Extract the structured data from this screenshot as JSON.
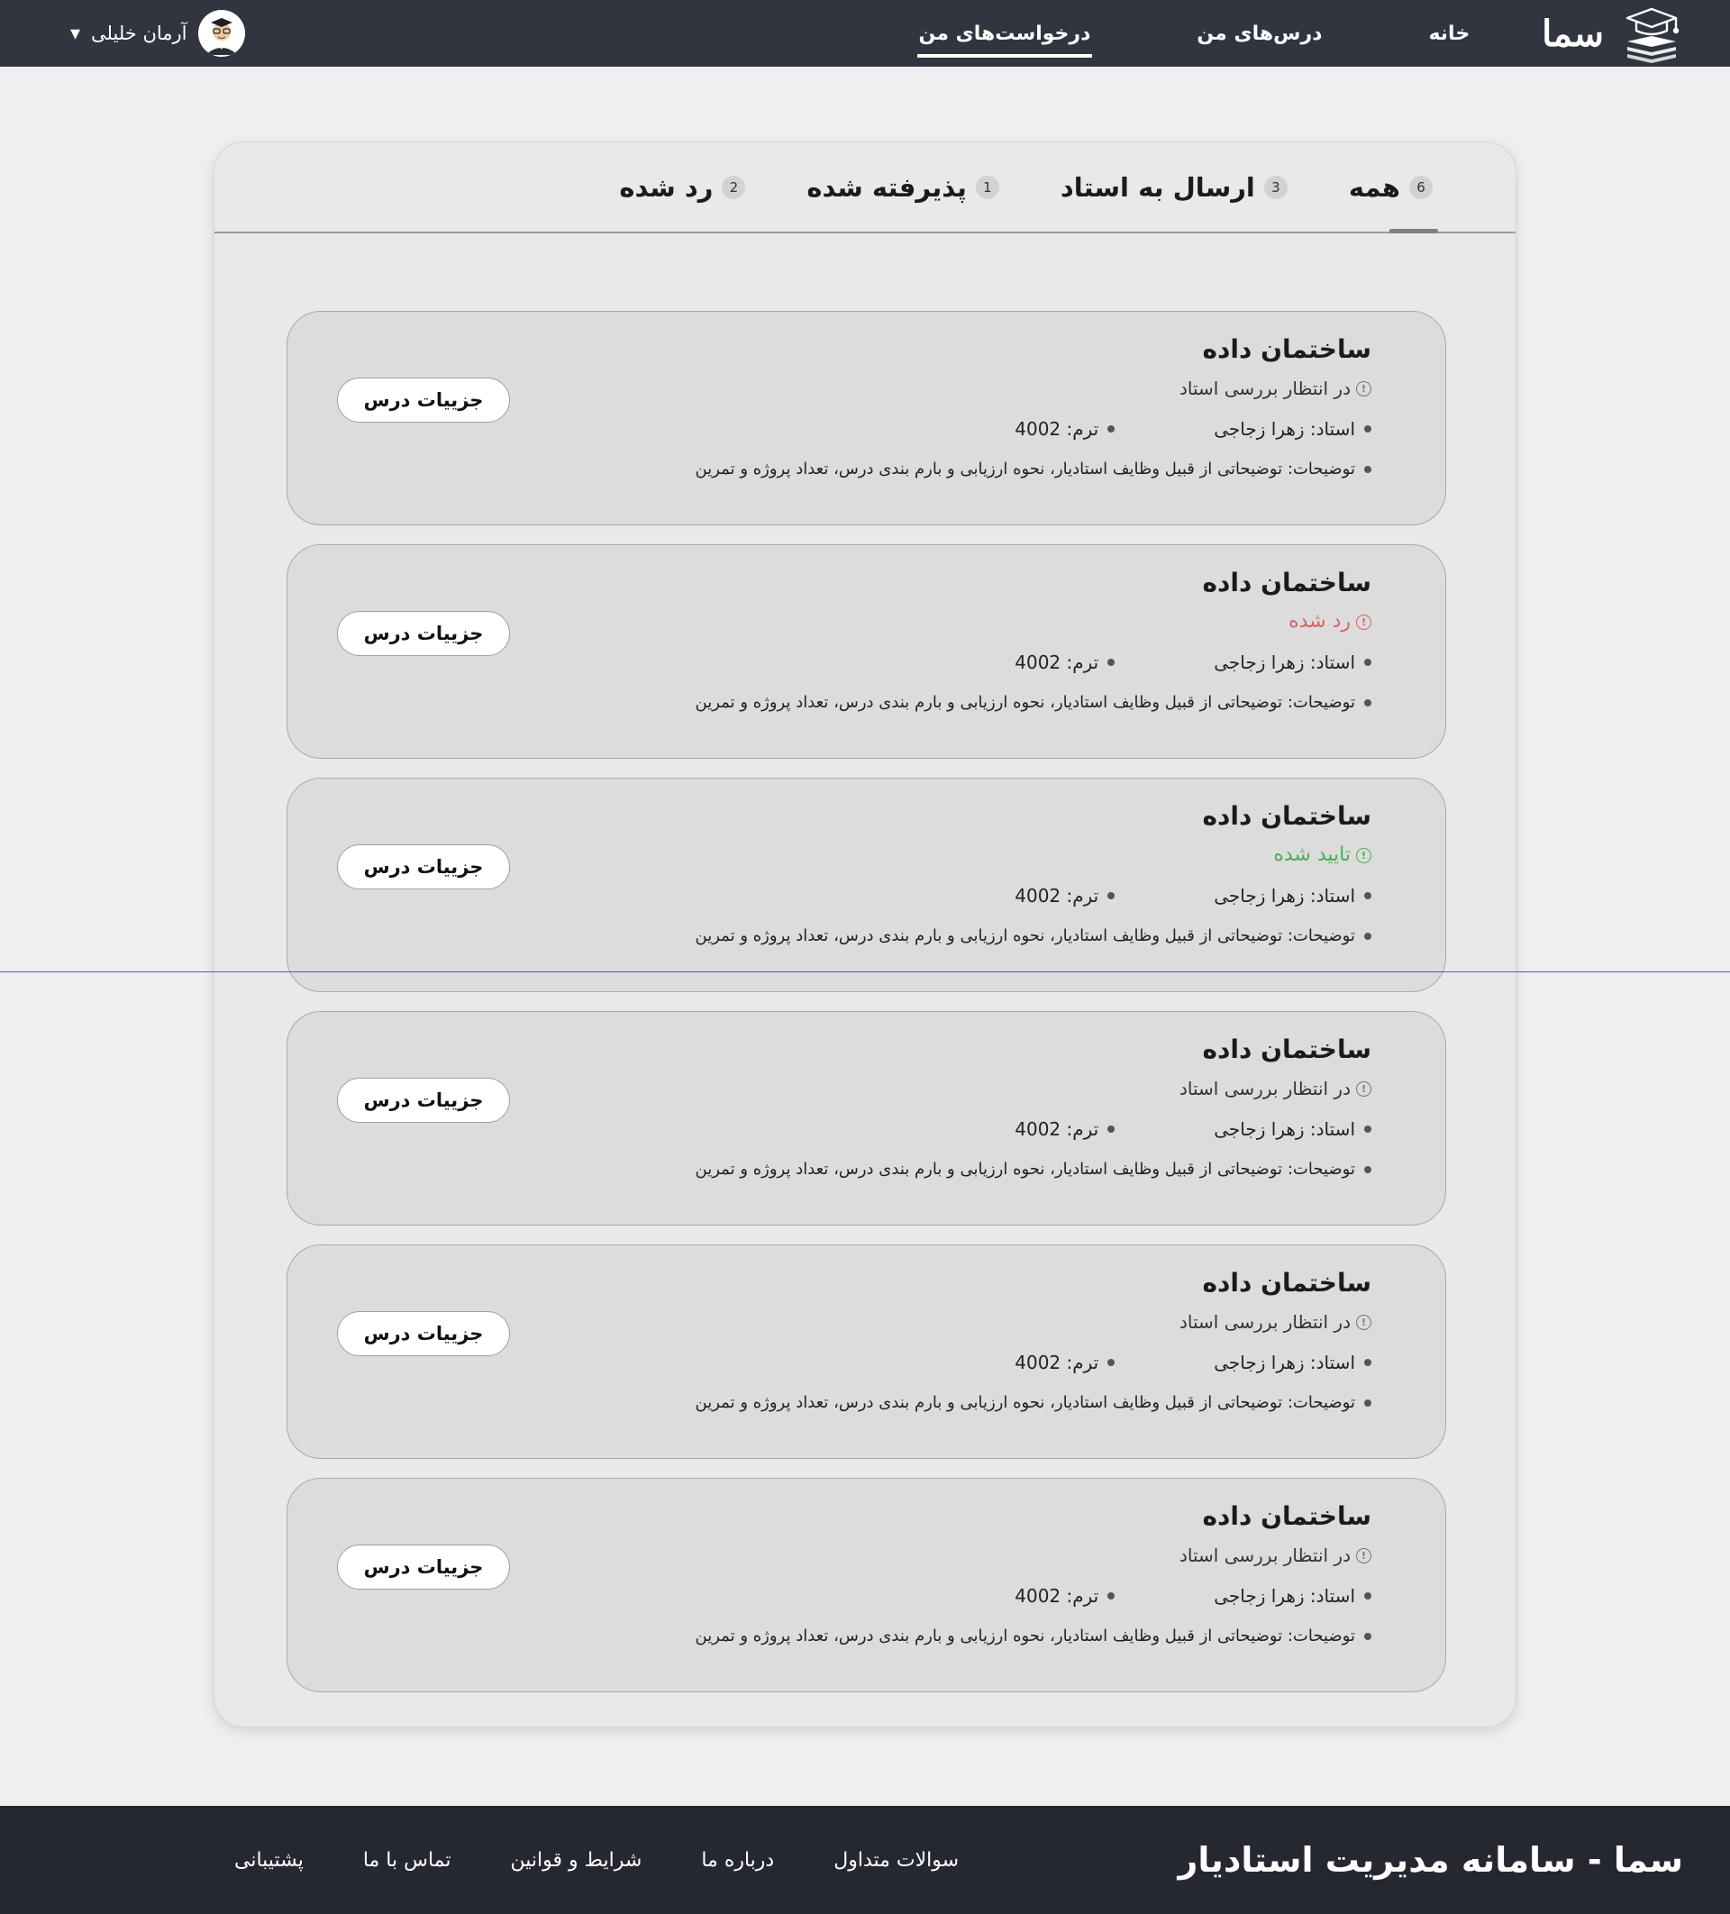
{
  "header": {
    "brand_name": "سما",
    "nav": [
      {
        "label": "خانه",
        "active": false
      },
      {
        "label": "درس‌های من",
        "active": false
      },
      {
        "label": "درخواست‌های من",
        "active": true
      }
    ],
    "user": {
      "name": "آرمان خلیلی",
      "caret": "▾"
    }
  },
  "tabs": [
    {
      "label": "همه",
      "count": "6",
      "active": true
    },
    {
      "label": "ارسال به استاد",
      "count": "3",
      "active": false
    },
    {
      "label": "پذیرفته شده",
      "count": "1",
      "active": false
    },
    {
      "label": "رد شده",
      "count": "2",
      "active": false
    }
  ],
  "cards": [
    {
      "title": "ساختمان داده",
      "status": "در انتظار بررسی استاد",
      "status_type": "pending",
      "teacher": "استاد: زهرا زجاجی",
      "term": "ترم: 4002",
      "description": "توضیحات: توضیحاتی از قبیل وظایف استادیار، نحوه ارزیابی و بارم بندی درس، تعداد پروژه و تمرین",
      "button": "جزییات درس"
    },
    {
      "title": "ساختمان داده",
      "status": "رد شده",
      "status_type": "rejected",
      "teacher": "استاد: زهرا زجاجی",
      "term": "ترم: 4002",
      "description": "توضیحات: توضیحاتی از قبیل وظایف استادیار، نحوه ارزیابی و بارم بندی درس، تعداد پروژه و تمرین",
      "button": "جزییات درس"
    },
    {
      "title": "ساختمان داده",
      "status": "تایید شده",
      "status_type": "approved",
      "teacher": "استاد: زهرا زجاجی",
      "term": "ترم: 4002",
      "description": "توضیحات: توضیحاتی از قبیل وظایف استادیار، نحوه ارزیابی و بارم بندی درس، تعداد پروژه و تمرین",
      "button": "جزییات درس"
    },
    {
      "title": "ساختمان داده",
      "status": "در انتظار بررسی استاد",
      "status_type": "pending",
      "teacher": "استاد: زهرا زجاجی",
      "term": "ترم: 4002",
      "description": "توضیحات: توضیحاتی از قبیل وظایف استادیار، نحوه ارزیابی و بارم بندی درس، تعداد پروژه و تمرین",
      "button": "جزییات درس"
    },
    {
      "title": "ساختمان داده",
      "status": "در انتظار بررسی استاد",
      "status_type": "pending",
      "teacher": "استاد: زهرا زجاجی",
      "term": "ترم: 4002",
      "description": "توضیحات: توضیحاتی از قبیل وظایف استادیار، نحوه ارزیابی و بارم بندی درس، تعداد پروژه و تمرین",
      "button": "جزییات درس"
    },
    {
      "title": "ساختمان داده",
      "status": "در انتظار بررسی استاد",
      "status_type": "pending",
      "teacher": "استاد: زهرا زجاجی",
      "term": "ترم: 4002",
      "description": "توضیحات: توضیحاتی از قبیل وظایف استادیار، نحوه ارزیابی و بارم بندی درس، تعداد پروژه و تمرین",
      "button": "جزییات درس"
    }
  ],
  "status_icon": "!",
  "footer": {
    "title": "سما - سامانه مدیریت استادیار",
    "links": [
      "سوالات متداول",
      "درباره ما",
      "شرایط و قوانین",
      "تماس با ما",
      "پشتیبانی"
    ]
  },
  "colors": {
    "header_bg": "#30353f",
    "footer_bg": "#252830",
    "rejected": "#e06060",
    "approved": "#4caf50"
  }
}
